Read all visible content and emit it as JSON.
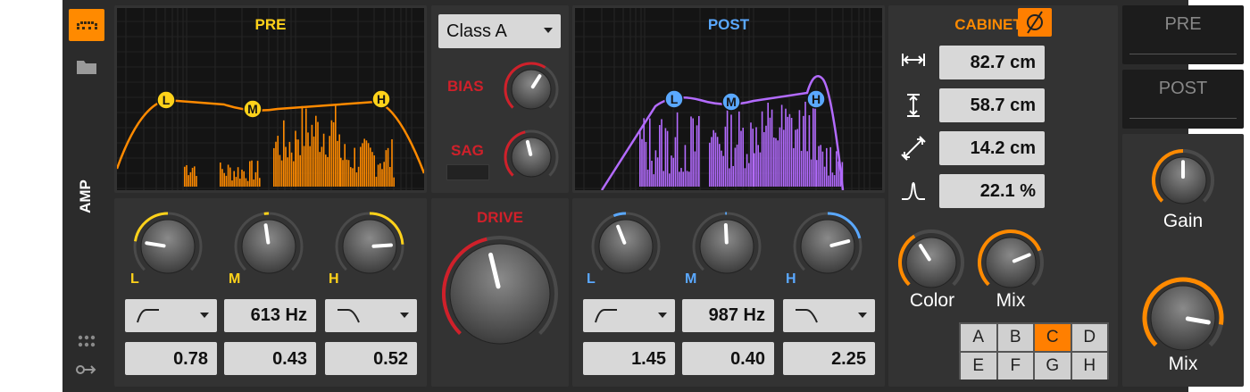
{
  "colors": {
    "orange": "#ff8a00",
    "yellow": "#ffd21a",
    "blue": "#5aa8ff",
    "purple": "#b36bff",
    "red": "#d0202a",
    "bg": "#2b2b2b",
    "panel": "#333333"
  },
  "sidebar": {
    "device_icon": "device-icon",
    "folder_icon": "folder-icon",
    "device_label": "AMP",
    "grid_icon": "grid-dots-icon",
    "routing_icon": "routing-icon"
  },
  "pre": {
    "title": "PRE",
    "nodes": [
      "L",
      "M",
      "H"
    ],
    "knobs": [
      {
        "label": "L",
        "value": 0.2
      },
      {
        "label": "M",
        "value": 0.47
      },
      {
        "label": "H",
        "value": 0.82
      }
    ],
    "shape_left_icon": "highpass-shape-icon",
    "freq": "613 Hz",
    "shape_right_icon": "lowpass-shape-icon",
    "q_values": [
      "0.78",
      "0.43",
      "0.52"
    ]
  },
  "amp": {
    "model": "Class A",
    "bias_label": "BIAS",
    "bias_value": 0.62,
    "sag_label": "SAG",
    "sag_value": 0.45,
    "drive_label": "DRIVE",
    "drive_value": 0.45
  },
  "post": {
    "title": "POST",
    "nodes": [
      "L",
      "M",
      "H"
    ],
    "knobs": [
      {
        "label": "L",
        "value": 0.42
      },
      {
        "label": "M",
        "value": 0.49
      },
      {
        "label": "H",
        "value": 0.78
      }
    ],
    "shape_left_icon": "highpass-shape-icon",
    "freq": "987 Hz",
    "shape_right_icon": "lowpass-shape-icon",
    "q_values": [
      "1.45",
      "0.40",
      "2.25"
    ]
  },
  "cabinet": {
    "title": "CABINET",
    "phase_icon": "phase-invert-icon",
    "params": [
      {
        "icon": "width-icon",
        "value": "82.7 cm"
      },
      {
        "icon": "height-icon",
        "value": "58.7 cm"
      },
      {
        "icon": "depth-icon",
        "value": "14.2 cm"
      },
      {
        "icon": "resonance-icon",
        "value": "22.1 %"
      }
    ],
    "color_label": "Color",
    "color_value": 0.38,
    "mix_label": "Mix",
    "mix_value": 0.75,
    "slots": [
      "A",
      "B",
      "C",
      "D",
      "E",
      "F",
      "G",
      "H"
    ],
    "active_slot": "C"
  },
  "output": {
    "pre_label": "PRE",
    "post_label": "POST",
    "gain_label": "Gain",
    "gain_value": 0.5,
    "mix_label": "Mix",
    "mix_value": 0.87
  }
}
